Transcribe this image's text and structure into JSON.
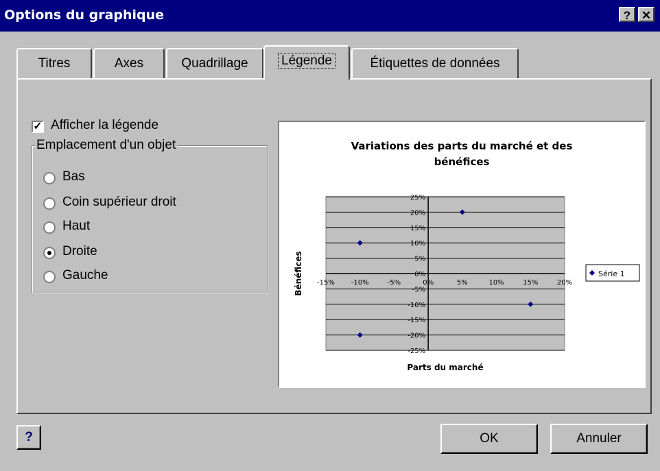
{
  "window": {
    "title": "Options du graphique",
    "help_btn": "?",
    "close_btn": "✕"
  },
  "tabs": [
    {
      "label": "Titres",
      "active": false
    },
    {
      "label": "Axes",
      "active": false
    },
    {
      "label": "Quadrillage",
      "active": false
    },
    {
      "label": "Légende",
      "active": true
    },
    {
      "label": "Étiquettes de données",
      "active": false
    }
  ],
  "legend_panel": {
    "show_legend_label": "Afficher la légende",
    "show_legend_checked": true,
    "placement_group_label": "Emplacement d'un objet",
    "placements": [
      {
        "label": "Bas",
        "checked": false
      },
      {
        "label": "Coin supérieur droit",
        "checked": false
      },
      {
        "label": "Haut",
        "checked": false
      },
      {
        "label": "Droite",
        "checked": true
      },
      {
        "label": "Gauche",
        "checked": false
      }
    ]
  },
  "chart_data": {
    "type": "scatter",
    "title": "Variations des parts du marché et des bénéfices",
    "xlabel": "Parts du marché",
    "ylabel": "Bénéfices",
    "xlim": [
      -15,
      20
    ],
    "ylim": [
      -25,
      25
    ],
    "x_ticks": [
      "-15%",
      "-10%",
      "-5%",
      "0%",
      "5%",
      "10%",
      "15%",
      "20%"
    ],
    "y_ticks": [
      "25%",
      "20%",
      "15%",
      "10%",
      "5%",
      "0%",
      "-5%",
      "-10%",
      "-15%",
      "-20%",
      "-25%"
    ],
    "grid": true,
    "legend_position": "right",
    "series": [
      {
        "name": "Série 1",
        "color": "#000080",
        "points": [
          [
            -10,
            10
          ],
          [
            5,
            20
          ],
          [
            15,
            -10
          ],
          [
            -10,
            -20
          ]
        ]
      }
    ]
  },
  "buttons": {
    "help_icon": "?",
    "ok": "OK",
    "cancel": "Annuler"
  }
}
